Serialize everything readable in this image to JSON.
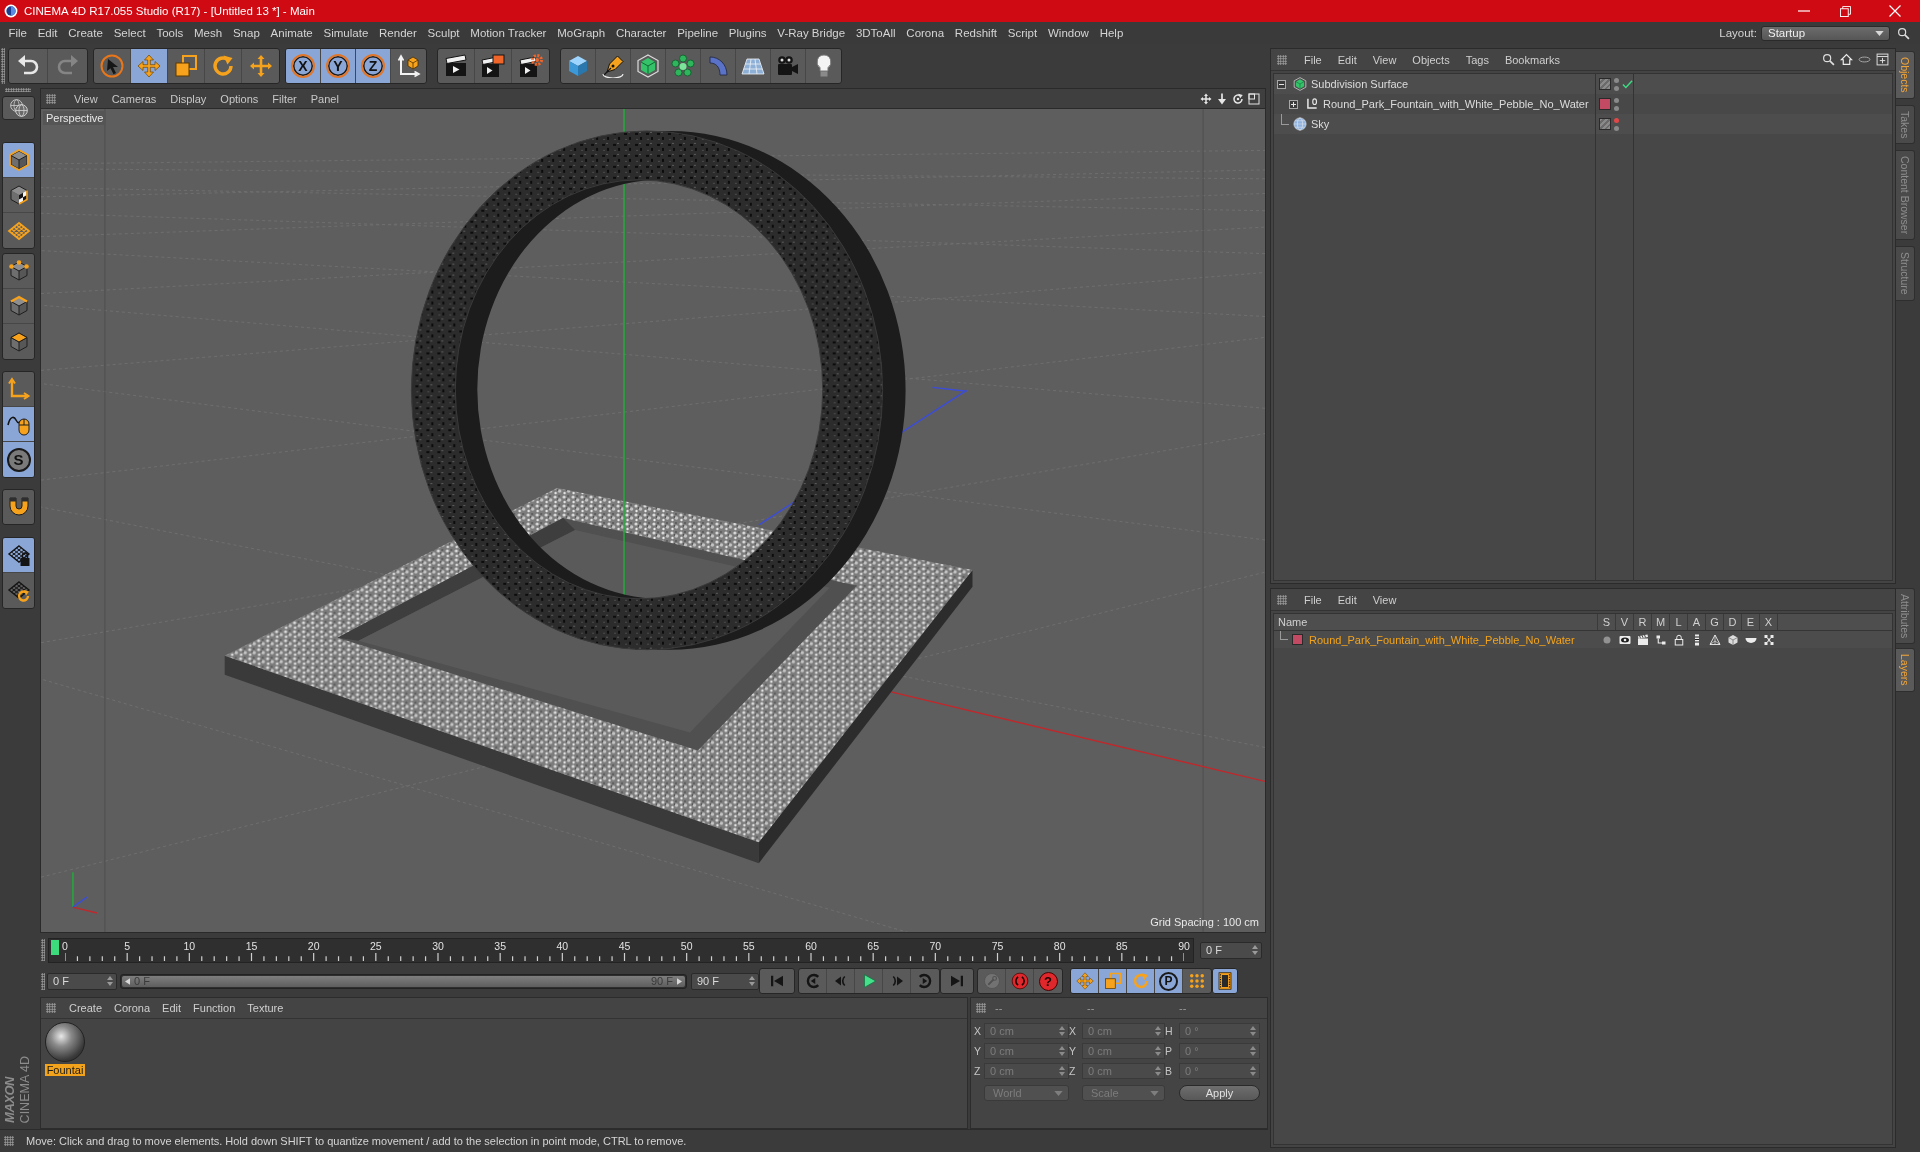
{
  "window": {
    "title": "CINEMA 4D R17.055 Studio (R17) - [Untitled 13 *] - Main"
  },
  "menu_bar": [
    "File",
    "Edit",
    "Create",
    "Select",
    "Tools",
    "Mesh",
    "Snap",
    "Animate",
    "Simulate",
    "Render",
    "Sculpt",
    "Motion Tracker",
    "MoGraph",
    "Character",
    "Pipeline",
    "Plugins",
    "V-Ray Bridge",
    "3DToAll",
    "Corona",
    "Redshift",
    "Script",
    "Window",
    "Help"
  ],
  "layout": {
    "label": "Layout:",
    "value": "Startup"
  },
  "toolbar": {
    "history": [
      {
        "disabled": false
      },
      {
        "disabled": true
      }
    ],
    "tools": [
      {
        "selected": false
      },
      {
        "selected": true
      },
      {
        "selected": false
      },
      {
        "selected": false
      },
      {
        "selected": false
      }
    ],
    "axes": [
      {
        "label": "X",
        "selected": true
      },
      {
        "label": "Y",
        "selected": true
      },
      {
        "label": "Z",
        "selected": true
      }
    ]
  },
  "left_toolbar": {
    "modes": [
      {
        "selected": true
      },
      {
        "selected": false
      },
      {
        "selected": false
      },
      {
        "selected": false
      },
      {
        "selected": false
      },
      {
        "selected": false
      }
    ],
    "tweak": [
      {
        "selected": false
      },
      {
        "selected": true
      },
      {
        "label": "S",
        "selected": true
      }
    ],
    "snap": {
      "selected": false
    },
    "workplane": [
      {
        "selected": true
      },
      {
        "selected": false
      }
    ]
  },
  "viewport": {
    "menu": [
      "View",
      "Cameras",
      "Display",
      "Options",
      "Filter",
      "Panel"
    ],
    "camera": "Perspective",
    "grid_spacing": "Grid Spacing : 100 cm"
  },
  "timeline": {
    "ticks": [
      "0",
      "5",
      "10",
      "15",
      "20",
      "25",
      "30",
      "35",
      "40",
      "45",
      "50",
      "55",
      "60",
      "65",
      "70",
      "75",
      "80",
      "85",
      "90"
    ],
    "level": 0,
    "current_frame": "0 F"
  },
  "transport": {
    "start": "0 F",
    "range": {
      "start": "0 F",
      "end": "90 F",
      "level": 1
    },
    "end": "90 F",
    "record": [
      {
        "disabled": true
      },
      {
        "disabled": false
      },
      {
        "label": "?",
        "disabled": false
      }
    ],
    "key_filters": [
      {
        "selected": true
      },
      {
        "selected": true
      },
      {
        "selected": true
      },
      {
        "label": "P",
        "selected": true
      },
      {
        "selected": false
      }
    ],
    "timeline_button": {
      "selected": true
    }
  },
  "material_manager": {
    "menu": [
      "Create",
      "Corona",
      "Edit",
      "Function",
      "Texture"
    ],
    "materials": [
      {
        "name": "Fountai",
        "selected": true
      }
    ]
  },
  "coordinates": {
    "headers": [
      "--",
      "--",
      "--"
    ],
    "rows": [
      [
        {
          "axis": "X",
          "value": "0 cm"
        },
        {
          "axis": "X",
          "value": "0 cm"
        },
        {
          "axis": "H",
          "value": "0 °"
        }
      ],
      [
        {
          "axis": "Y",
          "value": "0 cm"
        },
        {
          "axis": "Y",
          "value": "0 cm"
        },
        {
          "axis": "P",
          "value": "0 °"
        }
      ],
      [
        {
          "axis": "Z",
          "value": "0 cm"
        },
        {
          "axis": "Z",
          "value": "0 cm"
        },
        {
          "axis": "B",
          "value": "0 °"
        }
      ]
    ],
    "dropdowns": [
      "World",
      "Scale"
    ],
    "apply": "Apply",
    "disabled": true
  },
  "logo": {
    "brand": "MAXON",
    "product": "CINEMA 4D"
  },
  "status_bar": "Move: Click and drag to move elements. Hold down SHIFT to quantize movement / add to the selection in point mode, CTRL to remove.",
  "object_manager": {
    "menu": [
      "File",
      "Edit",
      "View",
      "Objects",
      "Tags",
      "Bookmarks"
    ],
    "objects": [
      {
        "name": "Subdivision Surface",
        "kind": "subdivision",
        "expanded": true,
        "selected": false,
        "editor_visible": true,
        "enabled": true,
        "children": [
          {
            "name": "Round_Park_Fountain_with_White_Pebble_No_Water",
            "kind": "null",
            "expanded": false,
            "selected": false,
            "editor_visible": true,
            "color": "#c24a63"
          }
        ]
      },
      {
        "name": "Sky",
        "kind": "sky",
        "selected": false,
        "editor_visible": false
      }
    ]
  },
  "layer_manager": {
    "menu": [
      "File",
      "Edit",
      "View"
    ],
    "columns": [
      "Name",
      "S",
      "V",
      "R",
      "M",
      "L",
      "A",
      "G",
      "D",
      "E",
      "X"
    ],
    "layers": [
      {
        "name": "Round_Park_Fountain_with_White_Pebble_No_Water",
        "color": "#c24a63",
        "selected": true,
        "toggles": [
          {
            "on": false
          },
          {
            "on": true
          },
          {
            "on": true
          },
          {
            "on": true
          },
          {
            "on": true
          },
          {
            "on": true
          },
          {
            "on": true
          },
          {
            "on": true
          },
          {
            "on": true
          },
          {
            "on": true
          }
        ]
      }
    ]
  },
  "side_tabs": {
    "top": [
      {
        "label": "Objects",
        "selected": true
      },
      {
        "label": "Takes",
        "selected": false
      },
      {
        "label": "Content Browser",
        "selected": false
      },
      {
        "label": "Structure",
        "selected": false
      }
    ],
    "bottom": [
      {
        "label": "Attributes",
        "selected": false
      },
      {
        "label": "Layers",
        "selected": true
      }
    ]
  }
}
